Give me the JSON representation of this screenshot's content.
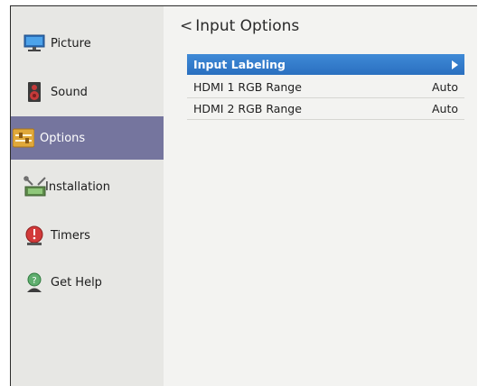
{
  "sidebar": {
    "items": [
      {
        "label": "Picture",
        "icon": "picture-monitor-icon"
      },
      {
        "label": "Sound",
        "icon": "speaker-icon"
      },
      {
        "label": "Options",
        "icon": "options-sliders-icon",
        "selected": true
      },
      {
        "label": "Installation",
        "icon": "installation-tools-icon"
      },
      {
        "label": "Timers",
        "icon": "timer-alarm-icon"
      },
      {
        "label": "Get Help",
        "icon": "help-person-icon"
      }
    ]
  },
  "page": {
    "back_glyph": "<",
    "title": "Input Options"
  },
  "menu": {
    "rows": [
      {
        "label": "Input Labeling",
        "value": "",
        "selected": true
      },
      {
        "label": "HDMI 1 RGB Range",
        "value": "Auto"
      },
      {
        "label": "HDMI 2 RGB Range",
        "value": "Auto"
      }
    ]
  },
  "colors": {
    "selected_sidebar": "#75759e",
    "selected_row": "#2a6fbf"
  }
}
